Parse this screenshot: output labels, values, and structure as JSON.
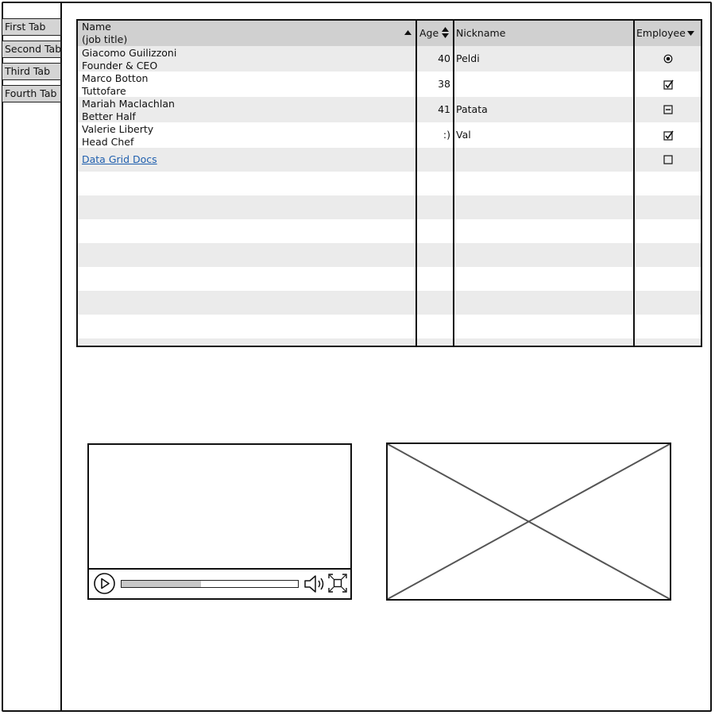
{
  "tabs": [
    {
      "label": "First Tab"
    },
    {
      "label": "Second Tab"
    },
    {
      "label": "Third Tab"
    },
    {
      "label": "Fourth Tab"
    }
  ],
  "grid": {
    "headers": {
      "name_line1": "Name",
      "name_line2": "(job title)",
      "age": "Age",
      "nickname": "Nickname",
      "employee": "Employee"
    },
    "rows": [
      {
        "name": "Giacomo Guilizzoni",
        "title": "Founder & CEO",
        "age": "40",
        "nickname": "Peldi",
        "employee": "radio-selected"
      },
      {
        "name": "Marco Botton",
        "title": "Tuttofare",
        "age": "38",
        "nickname": "",
        "employee": "checked"
      },
      {
        "name": "Mariah Maclachlan",
        "title": "Better Half",
        "age": "41",
        "nickname": "Patata",
        "employee": "indeterminate"
      },
      {
        "name": "Valerie Liberty",
        "title": "Head Chef",
        "age": ":)",
        "nickname": "Val",
        "employee": "checked"
      }
    ],
    "link_row": {
      "label": "Data Grid Docs",
      "employee": "unchecked"
    }
  },
  "video": {
    "progress": 0.45
  }
}
